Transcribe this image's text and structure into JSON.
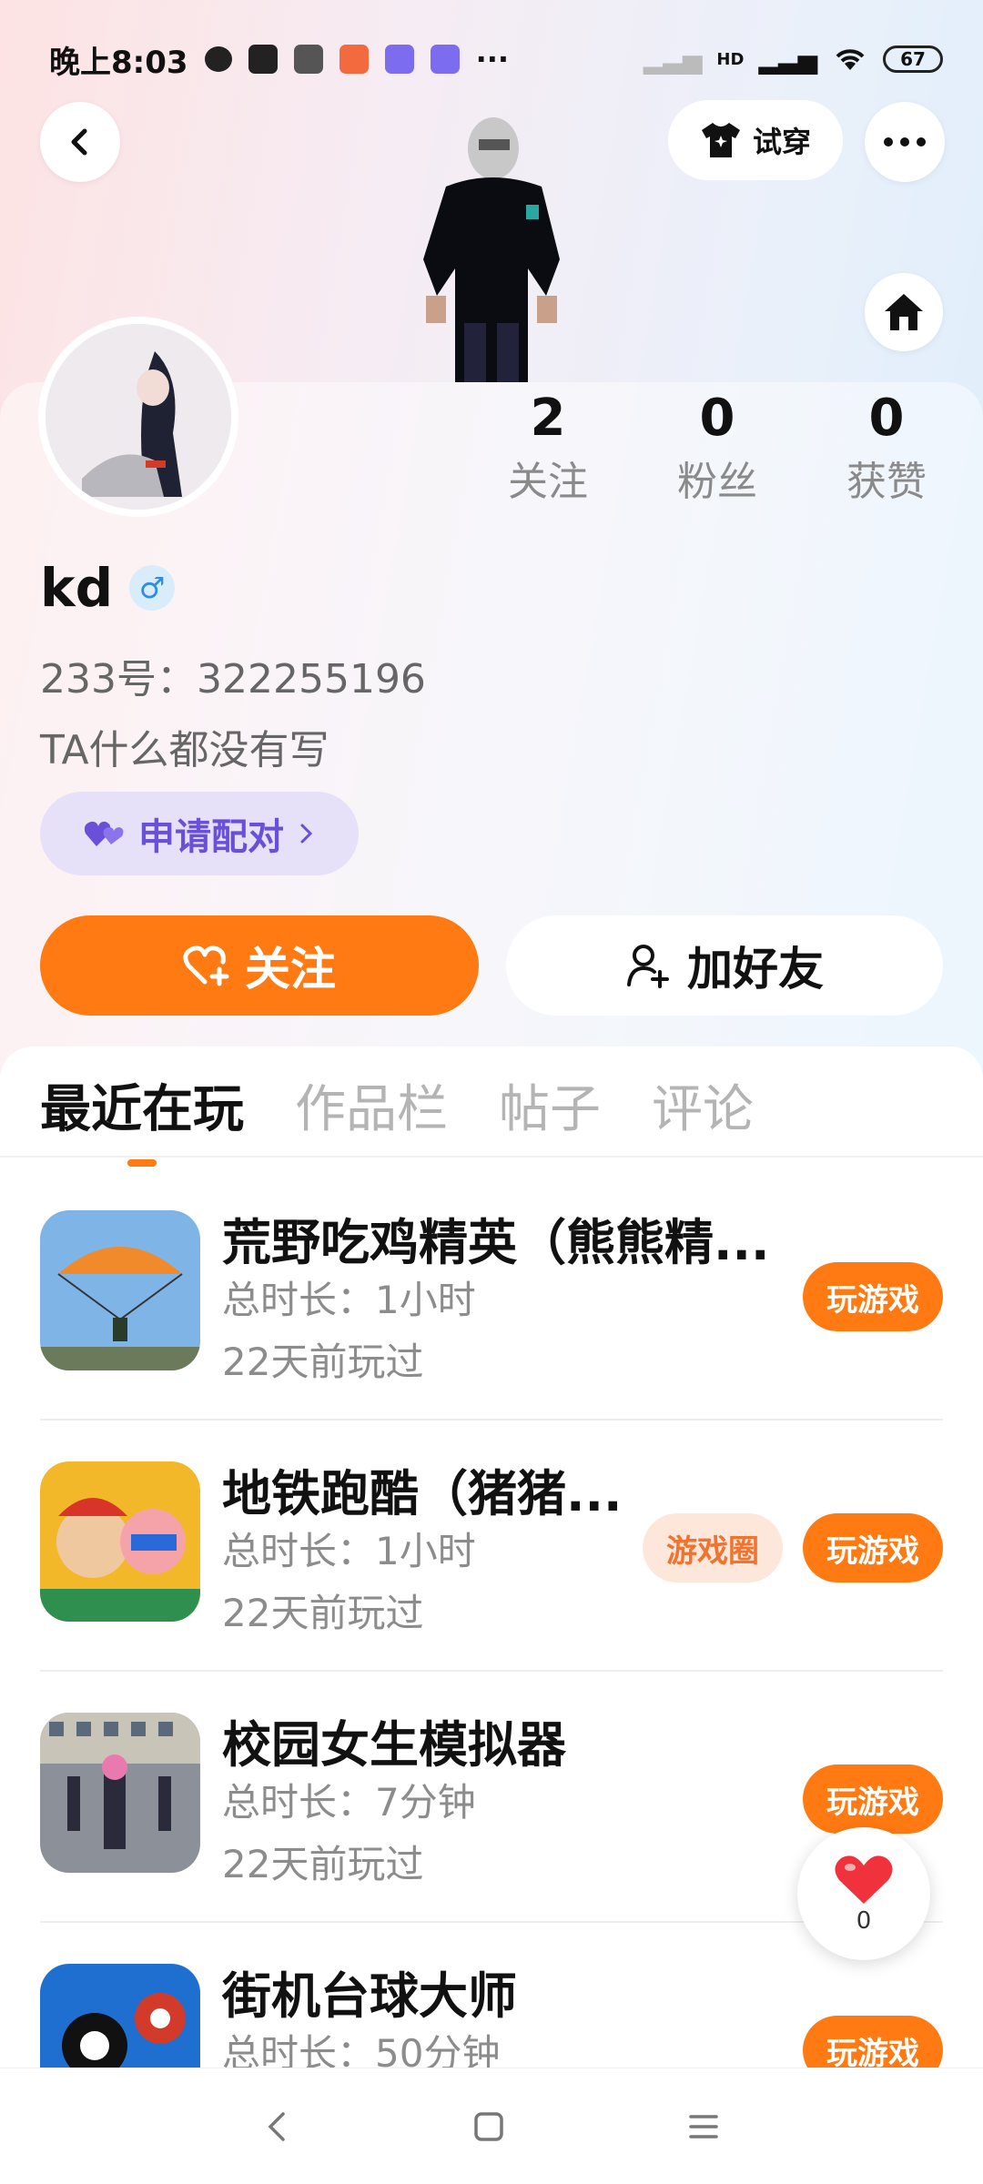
{
  "status_bar": {
    "time": "晚上8:03",
    "more_dots": "···",
    "network_label": "HD",
    "battery": "67"
  },
  "header": {
    "tryon_label": "试穿"
  },
  "stats": [
    {
      "value": "2",
      "label": "关注"
    },
    {
      "value": "0",
      "label": "粉丝"
    },
    {
      "value": "0",
      "label": "获赞"
    }
  ],
  "profile": {
    "username": "kd",
    "gender_symbol": "♂",
    "uid": "233号：322255196",
    "bio": "TA什么都没有写",
    "pair_label": "申请配对"
  },
  "actions": {
    "follow_label": "关注",
    "add_friend_label": "加好友"
  },
  "tabs": [
    {
      "label": "最近在玩",
      "active": true
    },
    {
      "label": "作品栏",
      "active": false
    },
    {
      "label": "帖子",
      "active": false
    },
    {
      "label": "评论",
      "active": false
    }
  ],
  "games": [
    {
      "title": "荒野吃鸡精英（熊熊精...",
      "duration": "总时长：1小时",
      "last_played": "22天前玩过",
      "play_label": "玩游戏"
    },
    {
      "title": "地铁跑酷（猪猪...",
      "duration": "总时长：1小时",
      "last_played": "22天前玩过",
      "circle_label": "游戏圈",
      "play_label": "玩游戏"
    },
    {
      "title": "校园女生模拟器",
      "duration": "总时长：7分钟",
      "last_played": "22天前玩过",
      "play_label": "玩游戏"
    },
    {
      "title": "街机台球大师",
      "duration": "总时长：50分钟",
      "play_label": "玩游戏"
    }
  ],
  "like_fab": {
    "count": "0"
  },
  "colors": {
    "accent": "#ff7a12",
    "pair": "#6a4fd8"
  }
}
